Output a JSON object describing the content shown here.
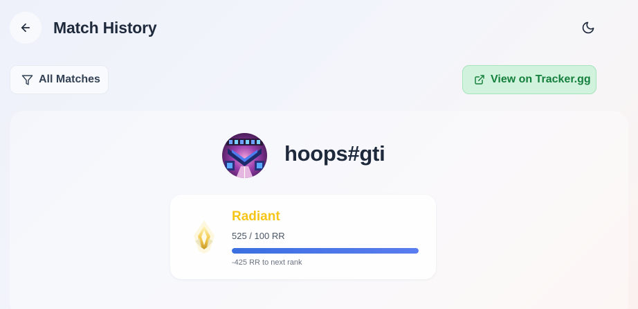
{
  "header": {
    "title": "Match History",
    "back_icon": "arrow-left-icon",
    "theme_icon": "moon-icon"
  },
  "toolbar": {
    "filter_label": "All Matches",
    "filter_icon": "filter-icon",
    "tracker_label": "View on Tracker.gg",
    "tracker_icon": "external-link-icon"
  },
  "profile": {
    "player_name": "hoops#gti",
    "rank": {
      "name": "Radiant",
      "rr_text": "525 / 100 RR",
      "progress_fraction": 1.0,
      "next_rank_text": "-425 RR to next rank",
      "color": "#f5c518"
    }
  },
  "colors": {
    "accent_green": "#15803d",
    "progress_blue": "#4f6fe8"
  }
}
